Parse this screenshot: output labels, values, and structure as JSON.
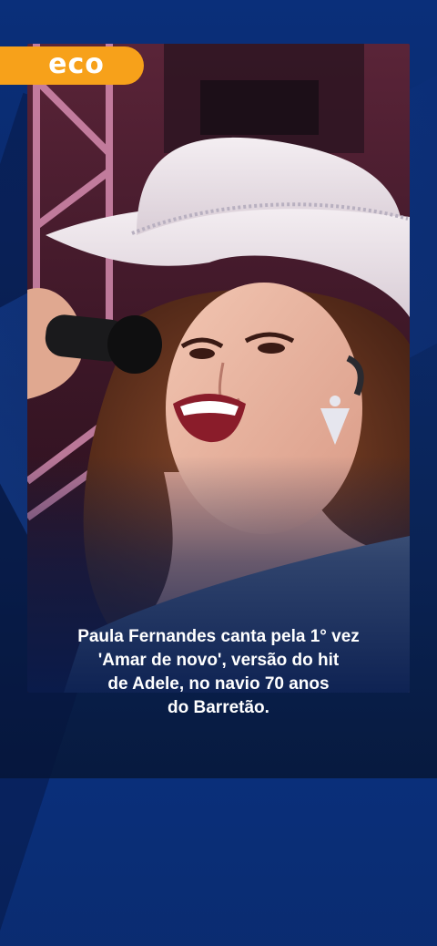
{
  "brand": {
    "logo_text": "eco",
    "logo_color": "#f7a11a",
    "background_color": "#0b2a6b"
  },
  "video": {
    "subject": "singer-in-white-cowboy-hat-with-microphone"
  },
  "caption": {
    "lines": [
      "Paula Fernandes canta pela 1° vez",
      "'Amar de novo', versão do hit",
      "de Adele, no navio 70 anos",
      "do Barretão."
    ]
  }
}
